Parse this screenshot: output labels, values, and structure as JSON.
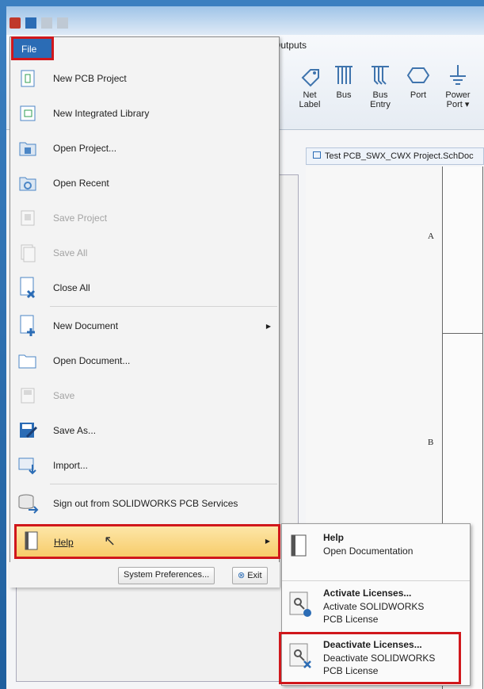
{
  "ribbon": {
    "tab_label": "Outputs",
    "buttons": [
      {
        "label": "Net",
        "label2": "Label"
      },
      {
        "label": "Bus",
        "label2": ""
      },
      {
        "label": "Bus",
        "label2": "Entry"
      },
      {
        "label": "Port",
        "label2": ""
      },
      {
        "label": "Power",
        "label2": "Port ▾"
      }
    ]
  },
  "panel": {
    "pin_close": "▼ ×"
  },
  "document_tab": {
    "label": "Test PCB_SWX_CWX Project.SchDoc"
  },
  "sheet": {
    "zone_a": "A",
    "zone_b": "B"
  },
  "file_menu": {
    "button_label": "File",
    "items": [
      {
        "label": "New PCB Project",
        "enabled": true
      },
      {
        "label": "New Integrated Library",
        "enabled": true
      },
      {
        "label": "Open Project...",
        "enabled": true
      },
      {
        "label": "Open Recent",
        "enabled": true
      },
      {
        "label": "Save Project",
        "enabled": false
      },
      {
        "label": "Save All",
        "enabled": false
      },
      {
        "label": "Close All",
        "enabled": true
      },
      {
        "label": "New Document",
        "enabled": true
      },
      {
        "label": "Open Document...",
        "enabled": true
      },
      {
        "label": "Save",
        "enabled": false
      },
      {
        "label": "Save As...",
        "enabled": true
      },
      {
        "label": "Import...",
        "enabled": true
      },
      {
        "label": "Sign out from SOLIDWORKS PCB Services",
        "enabled": true
      }
    ],
    "help": {
      "label": "Help"
    },
    "system_preferences": "System Preferences...",
    "exit": "Exit"
  },
  "help_submenu": [
    {
      "title": "Help",
      "desc": "Open Documentation"
    },
    {
      "title": "Activate Licenses...",
      "desc": "Activate SOLIDWORKS PCB License"
    },
    {
      "title": "Deactivate Licenses...",
      "desc": "Deactivate SOLIDWORKS PCB License"
    }
  ],
  "colors": {
    "highlight_border": "#d0171c",
    "file_button": "#2b6cb5",
    "help_row": "#f7cc6a"
  }
}
